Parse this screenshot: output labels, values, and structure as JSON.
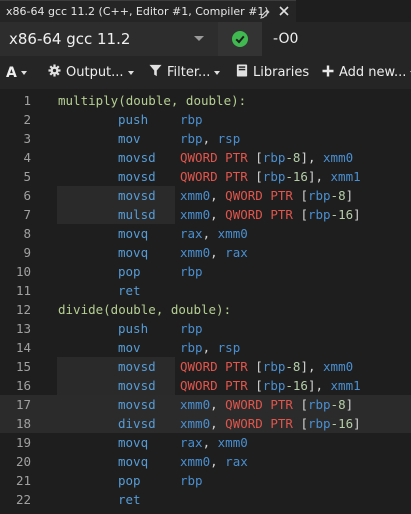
{
  "tab": {
    "title": "x86-64 gcc 11.2 (C++, Editor #1, Compiler #1)"
  },
  "compiler": {
    "name": "x86-64 gcc 11.2",
    "options": "-O0"
  },
  "toolbar": {
    "font_label": "A",
    "output_label": "Output...",
    "filter_label": "Filter...",
    "libraries_label": "Libraries",
    "add_new_label": "Add new..."
  },
  "colors": {
    "success": "#3fb950",
    "mnemonic": "#569cd6",
    "register": "#4a8fd0",
    "keyword": "#e0554c",
    "number": "#b5cea8",
    "label": "#b5cf92"
  },
  "asm": {
    "lines": [
      {
        "n": "1",
        "label": "multiply(double, double):"
      },
      {
        "n": "2",
        "op": "push",
        "args": [
          [
            "r",
            "rbp"
          ]
        ]
      },
      {
        "n": "3",
        "op": "mov",
        "args": [
          [
            "r",
            "rbp"
          ],
          [
            "p",
            ", "
          ],
          [
            "r",
            "rsp"
          ]
        ]
      },
      {
        "n": "4",
        "op": "movsd",
        "args": [
          [
            "k",
            "QWORD PTR "
          ],
          [
            "p",
            "["
          ],
          [
            "r",
            "rbp"
          ],
          [
            "n",
            "-8"
          ],
          [
            "p",
            "], "
          ],
          [
            "r",
            "xmm0"
          ]
        ]
      },
      {
        "n": "5",
        "op": "movsd",
        "args": [
          [
            "k",
            "QWORD PTR "
          ],
          [
            "p",
            "["
          ],
          [
            "r",
            "rbp"
          ],
          [
            "n",
            "-16"
          ],
          [
            "p",
            "], "
          ],
          [
            "r",
            "xmm1"
          ]
        ]
      },
      {
        "n": "6",
        "op": "movsd",
        "args": [
          [
            "r",
            "xmm0"
          ],
          [
            "p",
            ", "
          ],
          [
            "k",
            "QWORD PTR "
          ],
          [
            "p",
            "["
          ],
          [
            "r",
            "rbp"
          ],
          [
            "n",
            "-8"
          ],
          [
            "p",
            "]"
          ]
        ]
      },
      {
        "n": "7",
        "op": "mulsd",
        "args": [
          [
            "r",
            "xmm0"
          ],
          [
            "p",
            ", "
          ],
          [
            "k",
            "QWORD PTR "
          ],
          [
            "p",
            "["
          ],
          [
            "r",
            "rbp"
          ],
          [
            "n",
            "-16"
          ],
          [
            "p",
            "]"
          ]
        ]
      },
      {
        "n": "8",
        "op": "movq",
        "args": [
          [
            "r",
            "rax"
          ],
          [
            "p",
            ", "
          ],
          [
            "r",
            "xmm0"
          ]
        ]
      },
      {
        "n": "9",
        "op": "movq",
        "args": [
          [
            "r",
            "xmm0"
          ],
          [
            "p",
            ", "
          ],
          [
            "r",
            "rax"
          ]
        ]
      },
      {
        "n": "10",
        "op": "pop",
        "args": [
          [
            "r",
            "rbp"
          ]
        ]
      },
      {
        "n": "11",
        "op": "ret",
        "args": []
      },
      {
        "n": "12",
        "label": "divide(double, double):"
      },
      {
        "n": "13",
        "op": "push",
        "args": [
          [
            "r",
            "rbp"
          ]
        ]
      },
      {
        "n": "14",
        "op": "mov",
        "args": [
          [
            "r",
            "rbp"
          ],
          [
            "p",
            ", "
          ],
          [
            "r",
            "rsp"
          ]
        ]
      },
      {
        "n": "15",
        "op": "movsd",
        "args": [
          [
            "k",
            "QWORD PTR "
          ],
          [
            "p",
            "["
          ],
          [
            "r",
            "rbp"
          ],
          [
            "n",
            "-8"
          ],
          [
            "p",
            "], "
          ],
          [
            "r",
            "xmm0"
          ]
        ]
      },
      {
        "n": "16",
        "op": "movsd",
        "args": [
          [
            "k",
            "QWORD PTR "
          ],
          [
            "p",
            "["
          ],
          [
            "r",
            "rbp"
          ],
          [
            "n",
            "-16"
          ],
          [
            "p",
            "], "
          ],
          [
            "r",
            "xmm1"
          ]
        ]
      },
      {
        "n": "17",
        "op": "movsd",
        "args": [
          [
            "r",
            "xmm0"
          ],
          [
            "p",
            ", "
          ],
          [
            "k",
            "QWORD PTR "
          ],
          [
            "p",
            "["
          ],
          [
            "r",
            "rbp"
          ],
          [
            "n",
            "-8"
          ],
          [
            "p",
            "]"
          ]
        ]
      },
      {
        "n": "18",
        "op": "divsd",
        "args": [
          [
            "r",
            "xmm0"
          ],
          [
            "p",
            ", "
          ],
          [
            "k",
            "QWORD PTR "
          ],
          [
            "p",
            "["
          ],
          [
            "r",
            "rbp"
          ],
          [
            "n",
            "-16"
          ],
          [
            "p",
            "]"
          ]
        ]
      },
      {
        "n": "19",
        "op": "movq",
        "args": [
          [
            "r",
            "rax"
          ],
          [
            "p",
            ", "
          ],
          [
            "r",
            "xmm0"
          ]
        ]
      },
      {
        "n": "20",
        "op": "movq",
        "args": [
          [
            "r",
            "xmm0"
          ],
          [
            "p",
            ", "
          ],
          [
            "r",
            "rax"
          ]
        ]
      },
      {
        "n": "21",
        "op": "pop",
        "args": [
          [
            "r",
            "rbp"
          ]
        ]
      },
      {
        "n": "22",
        "op": "ret",
        "args": []
      }
    ]
  }
}
